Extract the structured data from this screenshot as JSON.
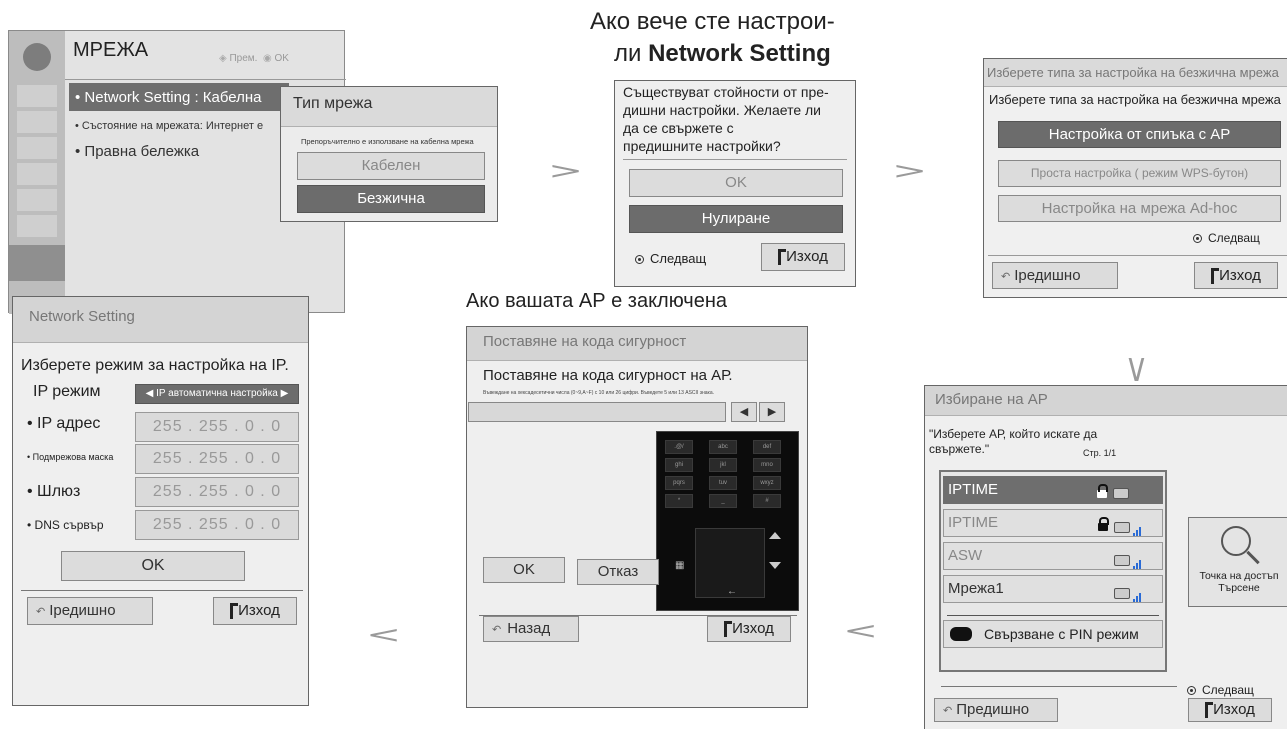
{
  "captions": {
    "already_set_line1": "Ако вече сте настрои-",
    "already_set_line2_prefix": "ли ",
    "already_set_line2_bold": "Network Setting",
    "ap_locked": "Ако вашата АР е заключена"
  },
  "menu": {
    "title": "МРЕЖА",
    "nav_hint": "Прем.",
    "ok_hint": "OK",
    "items": [
      {
        "label": "• Network Setting  : Кабелна"
      },
      {
        "label": "• Състояние на мрежата: Интернет е"
      },
      {
        "label": "• Правна бележка"
      }
    ]
  },
  "network_type": {
    "title": "Тип мрежа",
    "note": "Препоръчително е използване на кабелна мрежа",
    "options": [
      "Кабелен",
      "Безжична"
    ]
  },
  "previous_settings": {
    "message_lines": [
      "Съществуват стойности от пре-",
      "дишни настройки. Желаете ли",
      "да се свържете с",
      "предишните настройки?"
    ],
    "ok": "OK",
    "reset": "Нулиране",
    "next": "Следващ",
    "exit": "Изход"
  },
  "wireless_type": {
    "header": "Изберете типа за настройка на безжична мрежа",
    "subtitle": "Изберете типа за настройка на безжична мрежа",
    "options": [
      "Настройка от спиъка с AP",
      "Проста настройка ( режим WPS-бутон)",
      "Настройка на мрежа Ad-hoc"
    ],
    "next": "Следващ",
    "previous": "Іредишно",
    "exit": "Изход"
  },
  "ap_select": {
    "title": "Избиране на АР",
    "instruction_line1": "\"Изберете АР, който искате да",
    "instruction_line2": "свържете.\"",
    "page": "Стр. 1/1",
    "aps": [
      {
        "name": "IPTIME",
        "locked": true
      },
      {
        "name": "IPTIME",
        "locked": true
      },
      {
        "name": "ASW",
        "locked": false
      },
      {
        "name": "Мрежа1",
        "locked": false
      }
    ],
    "pin_mode": "Свързване с PIN режим",
    "search_line1": "Точка на достъп",
    "search_line2": "Търсене",
    "next": "Следващ",
    "previous": "Предишно",
    "exit": "Изход"
  },
  "security_code": {
    "header": "Поставяне на кода сигурност",
    "instruction": "Поставяне на кода сигурност на АР.",
    "hint": "Въвеждане на хексадесетични числа (0~9,A~F) с 10 или 26 цифри. Въведете 5 или 13 ASCII знака.",
    "ok": "OK",
    "cancel": "Отказ",
    "back": "Назад",
    "exit": "Изход",
    "keys": [
      ".@/",
      "abc",
      "def",
      "ghi",
      "jkl",
      "mno",
      "pqrs",
      "tuv",
      "wxyz",
      "*",
      "_",
      "#"
    ]
  },
  "ip_settings": {
    "header": "Network Setting",
    "instruction": "Изберете режим за настройка на IP.",
    "mode_label": "IP режим",
    "mode_value": "IP автоматична настройка",
    "fields": [
      {
        "label": "• IP адрес",
        "value": "255 . 255 . 0 . 0"
      },
      {
        "label": "• Подмрежова маска",
        "value": "255 . 255 . 0 . 0"
      },
      {
        "label": "• Шлюз",
        "value": "255 . 255 . 0 . 0"
      },
      {
        "label": "• DNS сървър",
        "value": "255 . 255 . 0 . 0"
      }
    ],
    "ok": "OK",
    "previous": "Іредишно",
    "exit": "Изход"
  },
  "colors": {
    "panel": "#e9e9e9",
    "header": "#d4d4d4",
    "selected": "#6c6c6c",
    "arrow": "#9a9a9a",
    "signal": "#2a6bd6"
  }
}
